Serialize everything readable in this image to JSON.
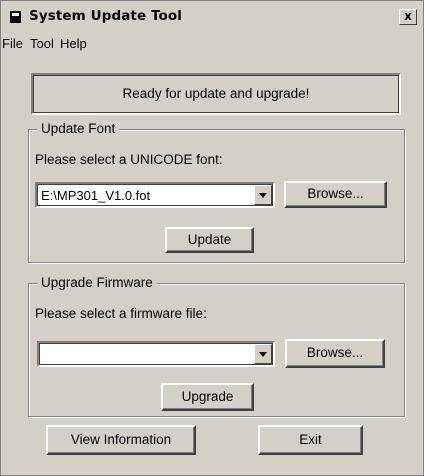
{
  "window": {
    "title": "System Update Tool",
    "close_label": "x"
  },
  "menu": [
    {
      "label": "File"
    },
    {
      "label": "Tool"
    },
    {
      "label": "Help"
    }
  ],
  "status": {
    "text": "Ready for update and upgrade!"
  },
  "update_font": {
    "group_title": "Update Font",
    "prompt": "Please select a UNICODE font:",
    "selected_file": "E:\\MP301_V1.0.fot",
    "browse_label": "Browse...",
    "action_label": "Update"
  },
  "upgrade_firmware": {
    "group_title": "Upgrade Firmware",
    "prompt": "Please select a firmware file:",
    "selected_file": "",
    "browse_label": "Browse...",
    "action_label": "Upgrade"
  },
  "footer": {
    "view_info_label": "View Information",
    "exit_label": "Exit"
  }
}
